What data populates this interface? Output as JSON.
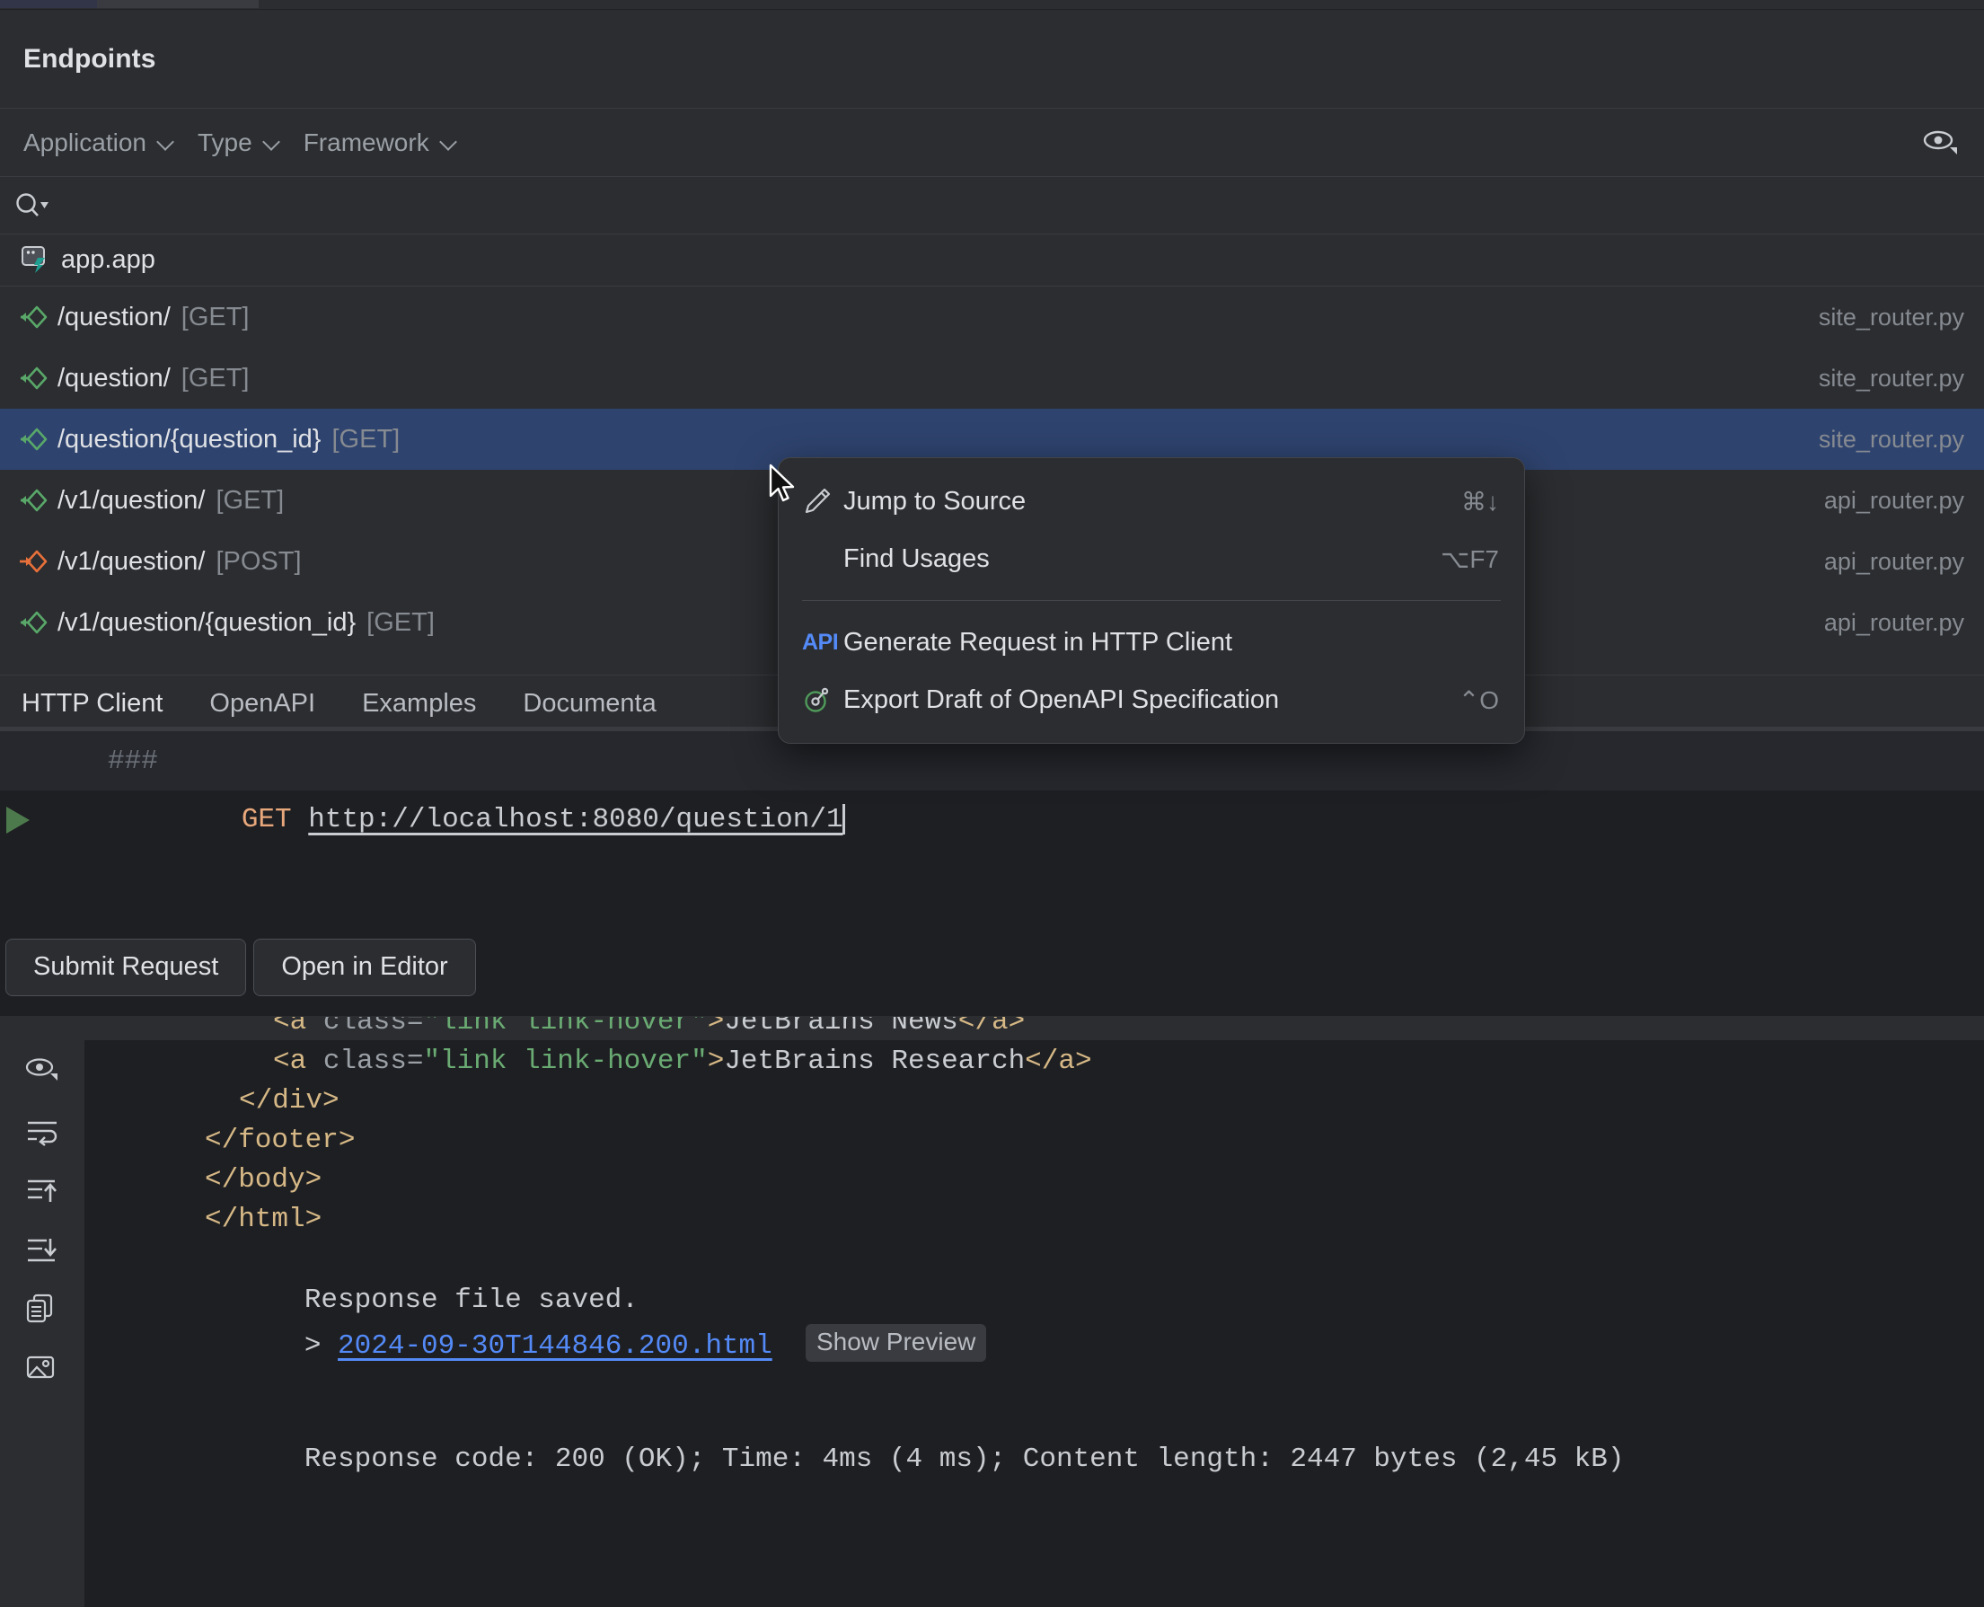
{
  "panel": {
    "title": "Endpoints"
  },
  "filters": [
    {
      "label": "Application",
      "icon": "chevron-down-icon"
    },
    {
      "label": "Type",
      "icon": "chevron-down-icon"
    },
    {
      "label": "Framework",
      "icon": "chevron-down-icon"
    }
  ],
  "toolbar": {
    "preview_icon": "eye-icon"
  },
  "search": {
    "icon": "search-icon",
    "value": "",
    "placeholder": ""
  },
  "tree": {
    "root": {
      "label": "app.app",
      "icon": "application-icon"
    },
    "endpoints": [
      {
        "path": "/question/",
        "method": "[GET]",
        "file": "site_router.py",
        "icon": "get-endpoint-icon",
        "selected": false
      },
      {
        "path": "/question/",
        "method": "[GET]",
        "file": "site_router.py",
        "icon": "get-endpoint-icon",
        "selected": false
      },
      {
        "path": "/question/{question_id}",
        "method": "[GET]",
        "file": "site_router.py",
        "icon": "get-endpoint-icon",
        "selected": true
      },
      {
        "path": "/v1/question/",
        "method": "[GET]",
        "file": "api_router.py",
        "icon": "get-endpoint-icon",
        "selected": false
      },
      {
        "path": "/v1/question/",
        "method": "[POST]",
        "file": "api_router.py",
        "icon": "post-endpoint-icon",
        "selected": false
      },
      {
        "path": "/v1/question/{question_id}",
        "method": "[GET]",
        "file": "api_router.py",
        "icon": "get-endpoint-icon",
        "selected": false
      }
    ]
  },
  "tabs": [
    {
      "label": "HTTP Client",
      "active": true
    },
    {
      "label": "OpenAPI",
      "active": false
    },
    {
      "label": "Examples",
      "active": false
    },
    {
      "label": "Documenta",
      "active": false
    }
  ],
  "editor": {
    "comment_line": "###",
    "run_icon": "run-triangle-icon",
    "method": "GET",
    "url": "http://localhost:8080/question/1"
  },
  "actions": {
    "submit_label": "Submit Request",
    "open_editor_label": "Open in Editor"
  },
  "context_menu": {
    "items": [
      {
        "label": "Jump to Source",
        "shortcut": "⌘↓",
        "icon": "pencil-icon"
      },
      {
        "label": "Find Usages",
        "shortcut": "⌥F7",
        "icon": "none"
      },
      {
        "label": "Generate Request in HTTP Client",
        "shortcut": "",
        "icon": "api-icon"
      },
      {
        "label": "Export Draft of OpenAPI Specification",
        "shortcut": "⌃O",
        "icon": "openapi-icon"
      }
    ]
  },
  "console": {
    "gutter_icons": [
      "eye-icon",
      "soft-wrap-icon",
      "scroll-to-top-icon",
      "scroll-to-bottom-icon",
      "copy-icon",
      "image-icon"
    ],
    "lines": [
      {
        "kind": "html_clipped",
        "indent": 3,
        "tag_open": "<a ",
        "attr": "class=",
        "val": "\"link link-hover\"",
        "gt": ">",
        "text": "JetBrains News",
        "tag_close": "</a>"
      },
      {
        "kind": "html_link",
        "indent": 3,
        "tag_open": "<a ",
        "attr": "class=",
        "val": "\"link link-hover\"",
        "gt": ">",
        "text": "JetBrains Research",
        "tag_close": "</a>"
      },
      {
        "kind": "tag",
        "indent": 2,
        "text": "</div>"
      },
      {
        "kind": "tag",
        "indent": 1,
        "text": "</footer>"
      },
      {
        "kind": "tag",
        "indent": 1,
        "text": "</body>"
      },
      {
        "kind": "tag",
        "indent": 1,
        "text": "</html>"
      }
    ],
    "saved_message": "Response file saved.",
    "file_prefix": ">",
    "file_link": "2024-09-30T144846.200.html",
    "preview_button": "Show Preview",
    "status": "Response code: 200 (OK); Time: 4ms (4 ms); Content length: 2447 bytes (2,45 kB)"
  },
  "colors": {
    "panel_bg": "#2b2d30",
    "editor_bg": "#1e1f22",
    "selection": "#2e436e",
    "accent_link": "#548af7",
    "get_icon": "#59a869",
    "post_icon": "#e8703a",
    "text_primary": "#dfe1e5",
    "text_muted": "#868a91"
  }
}
